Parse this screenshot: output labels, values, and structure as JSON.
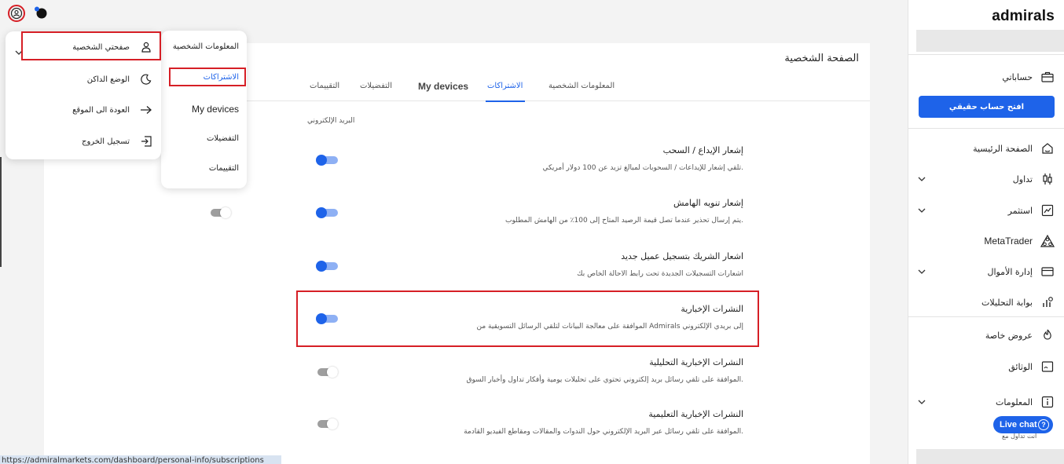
{
  "sidebar": {
    "logo": "admirals",
    "account_label": "حساباتي",
    "open_account_button": "افتح حساب حقيقي",
    "items": [
      {
        "label": "الصفحة الرئيسية",
        "icon": "home-icon",
        "has_chevron": false
      },
      {
        "label": "تداول",
        "icon": "candlestick-icon",
        "has_chevron": true
      },
      {
        "label": "استثمر",
        "icon": "chart-icon",
        "has_chevron": true
      },
      {
        "label": "MetaTrader",
        "icon": "metatrader-icon",
        "has_chevron": false
      },
      {
        "label": "إدارة الأموال",
        "icon": "wallet-icon",
        "has_chevron": true
      },
      {
        "label": "بوابة التحليلات",
        "icon": "analytics-icon",
        "has_chevron": false
      }
    ],
    "items2": [
      {
        "label": "عروض خاصة",
        "icon": "flame-icon"
      },
      {
        "label": "الوثائق",
        "icon": "document-icon"
      },
      {
        "label": "المعلومات",
        "icon": "info-icon"
      }
    ],
    "footnote": "أنت تداول مع"
  },
  "card": {
    "title": "الصفحة الشخصية",
    "tabs": [
      {
        "label": "المعلومات الشخصية",
        "active": false
      },
      {
        "label": "الاشتراكات",
        "active": true
      },
      {
        "label": "My devices",
        "active": false
      },
      {
        "label": "التفضيلات",
        "active": false
      },
      {
        "label": "التقييمات",
        "active": false
      }
    ],
    "email_label": "البريد الإلكتروني",
    "settings": [
      {
        "title": "إشعار الإيداع / السحب",
        "desc": "تلقي إشعار للإيداعات / السحوبات لمبالغ تزيد عن 100 دولار أمريكي.",
        "on": true
      },
      {
        "title": "إشعار تنويه الهامش",
        "desc": "يتم إرسال تحذير عندما تصل قيمة الرصيد المتاح إلى 100٪ من الهامش المطلوب.",
        "on": true
      },
      {
        "title": "اشعار الشريك بتسجيل عميل جديد",
        "desc": "اشعارات التسجيلات الجديدة تحت رابط الاحالة الخاص بك",
        "on": true
      },
      {
        "title": "النشرات الإخبارية",
        "desc": "الموافقة على معالجة البيانات لتلقي الرسائل التسويقية من Admirals إلى بريدي الإلكتروني",
        "on": true
      },
      {
        "title": "النشرات الإخبارية التحليلية",
        "desc": "الموافقة على تلقي رسائل بريد إلكتروني تحتوي على تحليلات يومية وأفكار تداول وأخبار السوق.",
        "on": false
      },
      {
        "title": "النشرات الإخبارية التعليمية",
        "desc": "الموافقة على تلقي رسائل عبر البريد الإلكتروني حول الندوات والمقالات ومقاطع الفيديو القادمة.",
        "on": false
      }
    ]
  },
  "submenu": {
    "items": [
      {
        "label": "المعلومات الشخصية",
        "active": false
      },
      {
        "label": "الاشتراكات",
        "active": true
      },
      {
        "label": "My devices",
        "active": false
      },
      {
        "label": "التفضيلات",
        "active": false
      },
      {
        "label": "التقييمات",
        "active": false
      }
    ]
  },
  "user_menu": {
    "items": [
      {
        "label": "صفحتي الشخصية",
        "icon": "person-icon"
      },
      {
        "label": "الوضع الداكن",
        "icon": "moon-icon"
      },
      {
        "label": "العودة الى الموقع",
        "icon": "arrow-right-icon"
      },
      {
        "label": "تسجيل الخروج",
        "icon": "logout-icon"
      }
    ]
  },
  "live_chat": "Live chat",
  "status_url": "https://admiralmarkets.com/dashboard/personal-info/subscriptions",
  "colors": {
    "accent": "#1e63e9",
    "highlight": "#d61f26"
  }
}
